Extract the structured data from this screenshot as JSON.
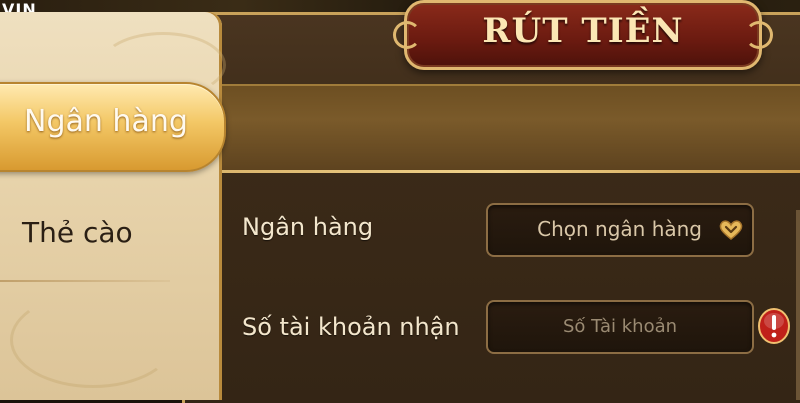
{
  "background": {
    "logo_fragment": "VIN"
  },
  "title": "RÚT TIỀN",
  "sidebar": {
    "tabs": [
      {
        "label": "Ngân hàng",
        "active": true
      },
      {
        "label": "Thẻ cào",
        "active": false
      }
    ]
  },
  "form": {
    "bank": {
      "label": "Ngân hàng",
      "value": "Chọn ngân hàng",
      "icon": "dropdown-heart-icon"
    },
    "account": {
      "label": "Số tài khoản nhận",
      "placeholder": "Số Tài khoản",
      "icon": "alert-icon"
    }
  },
  "colors": {
    "accent_gold": "#e0b870",
    "banner_red": "#6a1a10",
    "panel_brown": "#3b2a18",
    "sidebar_beige": "#e8d4ac",
    "alert_red": "#c0201a"
  }
}
